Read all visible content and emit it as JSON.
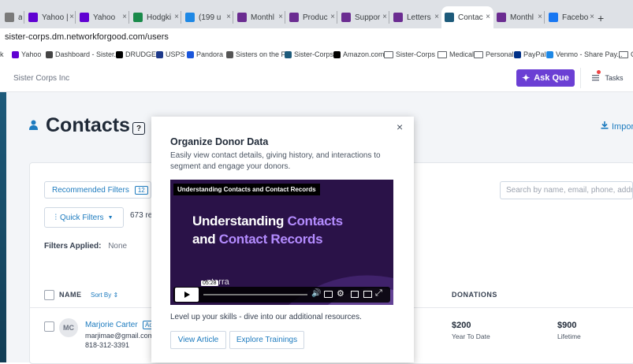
{
  "browser": {
    "tabs": [
      {
        "label": "a",
        "color": "#7a7a7a"
      },
      {
        "label": "Yahoo |",
        "color": "#6001d2"
      },
      {
        "label": "Yahoo",
        "color": "#6001d2"
      },
      {
        "label": "Hodgki",
        "color": "#1a8a4a"
      },
      {
        "label": "(199 u",
        "color": "#1e88e5"
      },
      {
        "label": "Monthl",
        "color": "#6b2c91"
      },
      {
        "label": "Produc",
        "color": "#6b2c91"
      },
      {
        "label": "Suppor",
        "color": "#6b2c91"
      },
      {
        "label": "Letters",
        "color": "#6b2c91"
      },
      {
        "label": "Contac",
        "color": "#1d5a7a"
      },
      {
        "label": "Monthl",
        "color": "#6b2c91"
      },
      {
        "label": "Facebo",
        "color": "#1877f2"
      }
    ],
    "new_tab": "+",
    "url": "sister-corps.dm.networkforgood.com/users",
    "bookmarks": [
      "k",
      "Yahoo",
      "Dashboard - Sister...",
      "DRUDGE",
      "USPS",
      "Pandora",
      "Sisters on the Fly",
      "Sister-Corps",
      "Amazon.com",
      "Sister-Corps",
      "Medical",
      "Personal",
      "PayPal",
      "Venmo - Share Pay...",
      "C"
    ]
  },
  "header": {
    "org_name": "Sister Corps Inc",
    "ask_button": "Ask Que",
    "tasks": "Tasks"
  },
  "page": {
    "title": "Contacts",
    "help": "?",
    "import": "Impor",
    "recommended_filters": "Recommended Filters",
    "recommended_count": "12",
    "quick_filters": "Quick Filters",
    "contact_count": "673 re",
    "filters_applied_label": "Filters Applied:",
    "filters_applied_value": "None",
    "search_placeholder": "Search by name, email, phone, addre",
    "col_name": "NAME",
    "sort_by": "Sort By",
    "col_donations": "DONATIONS"
  },
  "contact": {
    "initials": "MC",
    "name": "Marjorie Carter",
    "badge": "Ac",
    "email": "marjimae@gmail.com",
    "phone": "818-312-3391",
    "ytd_value": "$200",
    "ytd_label": "Year To Date",
    "lifetime_value": "$900",
    "lifetime_label": "Lifetime"
  },
  "modal": {
    "close": "×",
    "title": "Organize Donor Data",
    "description": "Easily view contact details, giving history, and interactions to segment and engage your donors.",
    "video_label": "Understanding Contacts and Contact Records",
    "video_head1_a": "Understanding ",
    "video_head1_b": "Contacts",
    "video_head2_a": "and ",
    "video_head2_b": "Contact Records",
    "video_brand": "nterra",
    "video_time": "05:28",
    "level_up": "Level up your skills - dive into our additional resources.",
    "view_article": "View Article",
    "explore_trainings": "Explore Trainings"
  },
  "colors": {
    "accent": "#1d7bbf",
    "ask": "#6b3fd4",
    "sidebar": "#1d5a7a"
  }
}
